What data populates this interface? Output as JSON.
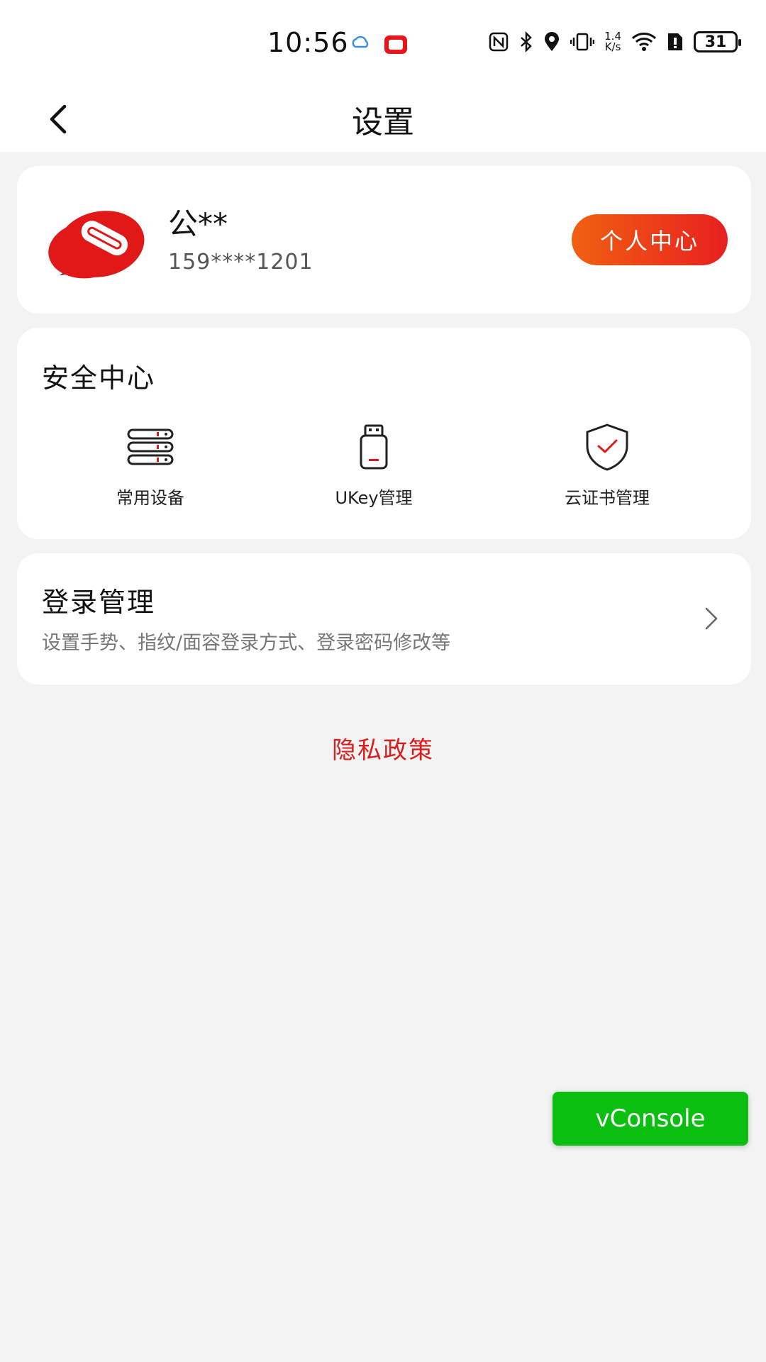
{
  "status_bar": {
    "time": "10:56",
    "net_speed_value": "1.4",
    "net_speed_unit": "K/s",
    "battery": "31"
  },
  "nav": {
    "title": "设置"
  },
  "profile": {
    "name": "公**",
    "phone": "159****1201",
    "center_button": "个人中心"
  },
  "security": {
    "title": "安全中心",
    "items": [
      {
        "label": "常用设备",
        "icon": "device-list-icon"
      },
      {
        "label": "UKey管理",
        "icon": "usb-key-icon"
      },
      {
        "label": "云证书管理",
        "icon": "shield-check-icon"
      }
    ]
  },
  "login": {
    "title": "登录管理",
    "subtitle": "设置手势、指纹/面容登录方式、登录密码修改等"
  },
  "privacy": {
    "label": "隐私政策"
  },
  "vconsole": {
    "label": "vConsole"
  },
  "colors": {
    "accent_red": "#d81e1e",
    "button_gradient_start": "#f06010",
    "button_gradient_end": "#e82020",
    "vconsole_green": "#0bbf11",
    "page_bg": "#f3f3f3"
  }
}
